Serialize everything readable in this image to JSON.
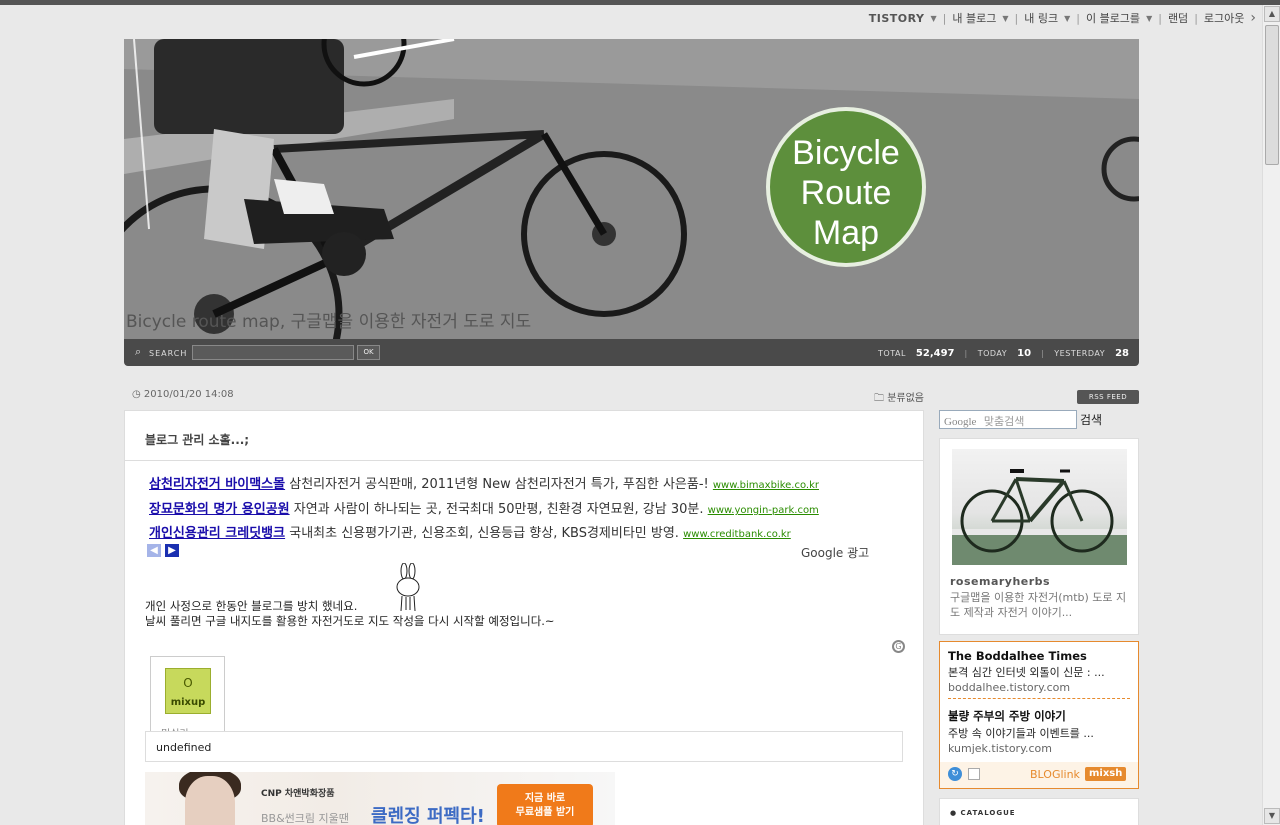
{
  "topbar": {
    "logo": "TISTORY",
    "items": [
      "내 블로그",
      "내 링크",
      "이 블로그를",
      "랜덤",
      "로그아웃"
    ]
  },
  "header": {
    "badge_lines": [
      "Bicycle",
      "Route",
      "Map"
    ],
    "subtitle": "Bicycle route map, 구글맵을 이용한 자전거 도로 지도",
    "search_label": "SEARCH",
    "search_ok": "OK",
    "counter": {
      "total_label": "TOTAL",
      "total_value": "52,497",
      "today_label": "TODAY",
      "today_value": "10",
      "yesterday_label": "YESTERDAY",
      "yesterday_value": "28"
    }
  },
  "post": {
    "date": "2010/01/20 14:08",
    "category": "분류없음",
    "title": "블로그 관리 소홀...;",
    "ads": [
      {
        "link": "삼천리자전거 바이맥스몰",
        "desc": "삼천리자전거 공식판매, 2011년형 New 삼천리자전거 특가, 푸짐한 사은품-!",
        "url": "www.bimaxbike.co.kr"
      },
      {
        "link": "장묘문화의 명가 용인공원",
        "desc": "자연과 사람이 하나되는 곳, 전국최대 50만평, 친환경 자연묘원, 강남 30분.",
        "url": "www.yongin-park.com"
      },
      {
        "link": "개인신용관리 크레딧뱅크",
        "desc": "국내최초 신용평가기관, 신용조회, 신용등급 향상, KBS경제비타민 방영.",
        "url": "www.creditbank.co.kr"
      }
    ],
    "google_ad": "Google 광고",
    "body_lines": [
      "개인 사정으로 한동안 블로그를 방치 했네요.",
      "날씨 풀리면 구글 내지도를 활용한 자전거도로 지도 작성을 다시 시작할 예정입니다.~"
    ],
    "mixup_logo": "mixup",
    "mixup_footer": "믹쉬기",
    "undefined_text": "undefined",
    "banner": {
      "brand": "CNP 차앤박화장품",
      "slogan": "BB&썬크림 지울땐",
      "headline": "클렌징 퍼펙타!",
      "cta": "지금 바로\n무료샘플 받기"
    }
  },
  "sidebar": {
    "rss": "RSS FEED",
    "search_placeholder": "맞춤검색",
    "search_logo": "Google",
    "search_button": "검색",
    "blog": {
      "name": "rosemaryherbs",
      "desc": "구글맵을 이용한 자전거(mtb) 도로 지도 제작과 자전거 이야기..."
    },
    "bloglink": {
      "items": [
        {
          "title": "The Boddalhee Times",
          "desc": "본격 심간 인터넷 외톨이 신문 : ...",
          "url": "boddalhee.tistory.com"
        },
        {
          "title": "불량 주부의 주방 이야기",
          "desc": "주방 속 이야기들과 이벤트를 ...",
          "url": "kumjek.tistory.com"
        }
      ],
      "brand": "BLOGlink",
      "badge": "mixsh"
    },
    "catalogue": "CATALOGUE"
  }
}
